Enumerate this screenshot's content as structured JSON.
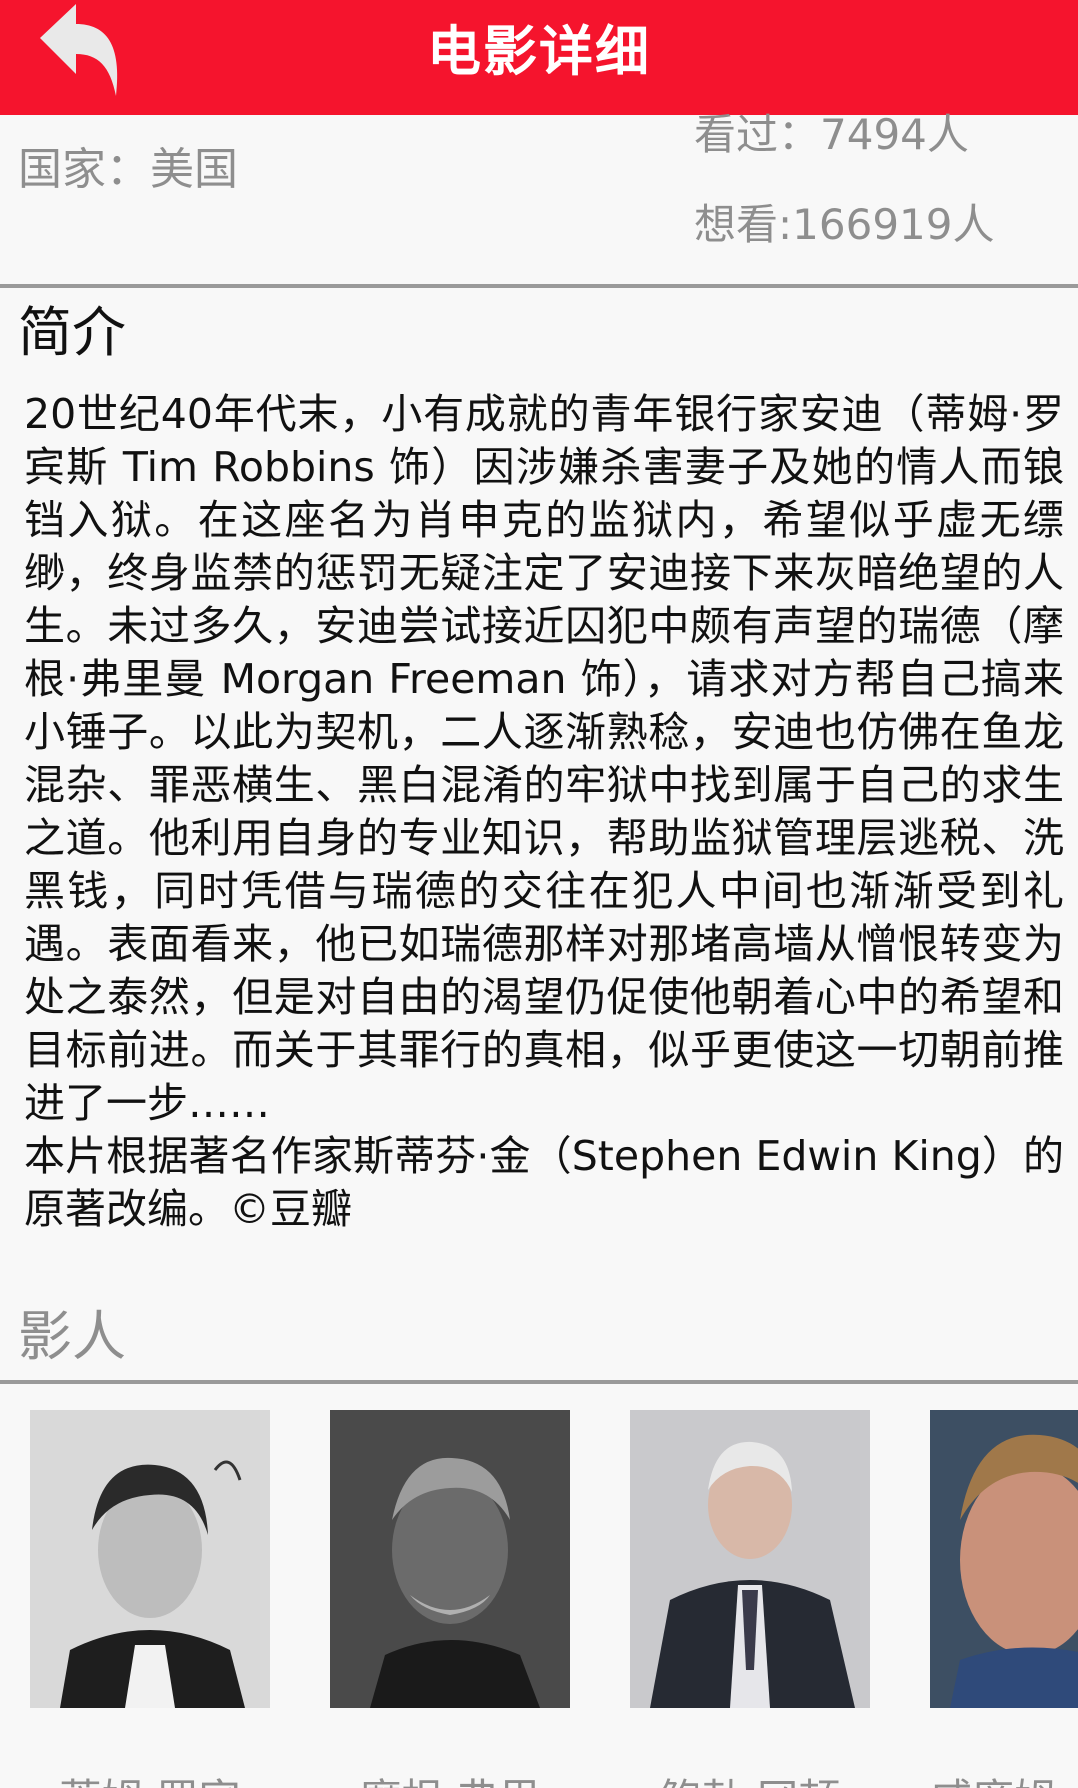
{
  "header": {
    "title": "电影详细",
    "back_icon": "back-arrow-icon",
    "background_color": "#f5142d"
  },
  "info": {
    "country": "国家：美国",
    "seen": "看过：7494人",
    "want": "想看:166919人"
  },
  "summary": {
    "heading": "简介",
    "paragraph1": "20世纪40年代末，小有成就的青年银行家安迪（蒂姆·罗宾斯 Tim Robbins 饰）因涉嫌杀害妻子及她的情人而锒铛入狱。在这座名为肖申克的监狱内，希望似乎虚无缥缈，终身监禁的惩罚无疑注定了安迪接下来灰暗绝望的人生。未过多久，安迪尝试接近囚犯中颇有声望的瑞德（摩根·弗里曼 Morgan Freeman 饰），请求对方帮自己搞来小锤子。以此为契机，二人逐渐熟稔，安迪也仿佛在鱼龙混杂、罪恶横生、黑白混淆的牢狱中找到属于自己的求生之道。他利用自身的专业知识，帮助监狱管理层逃税、洗黑钱，同时凭借与瑞德的交往在犯人中间也渐渐受到礼遇。表面看来，他已如瑞德那样对那堵高墙从憎恨转变为处之泰然，但是对自由的渴望仍促使他朝着心中的希望和目标前进。而关于其罪行的真相，似乎更使这一切朝前推进了一步……",
    "paragraph2": "本片根据著名作家斯蒂芬·金（Stephen Edwin King）的原著改编。©豆瓣"
  },
  "cast": {
    "heading": "影人",
    "members": [
      {
        "name": "蒂姆·罗宾"
      },
      {
        "name": "摩根·弗里"
      },
      {
        "name": "鲍勃·冈顿"
      },
      {
        "name": "威廉姆"
      }
    ]
  }
}
